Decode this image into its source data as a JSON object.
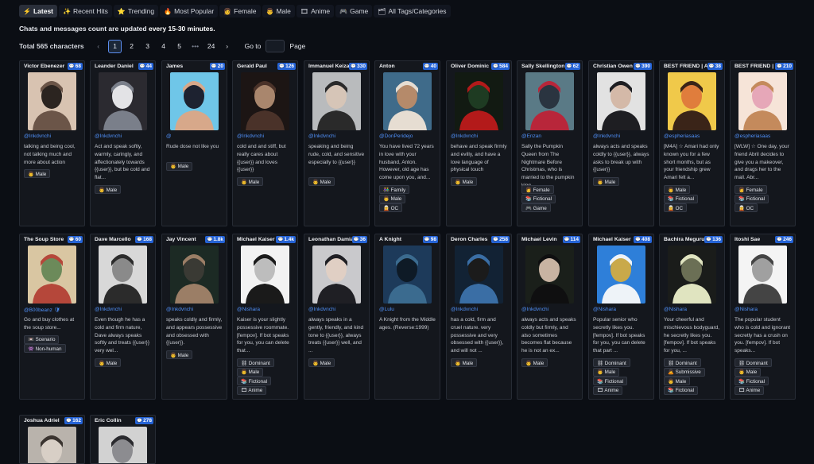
{
  "tabs": [
    {
      "icon": "⚡",
      "label": "Latest"
    },
    {
      "icon": "✨",
      "label": "Recent Hits"
    },
    {
      "icon": "⭐",
      "label": "Trending"
    },
    {
      "icon": "🔥",
      "label": "Most Popular"
    },
    {
      "icon": "👩",
      "label": "Female"
    },
    {
      "icon": "👨",
      "label": "Male"
    },
    {
      "icon": "🎞",
      "label": "Anime"
    },
    {
      "icon": "🎮",
      "label": "Game"
    },
    {
      "icon": "🗂",
      "label": "All Tags/Categories"
    }
  ],
  "notice": {
    "prefix": "Chats and messages count are updated ",
    "strong": "every 15-30 minutes."
  },
  "pagination": {
    "total_prefix": "Total ",
    "total_count": "565",
    "total_suffix": " characters",
    "prev": "‹",
    "pages": [
      "1",
      "2",
      "3",
      "4",
      "5"
    ],
    "ellipsis": "•••",
    "last": "24",
    "next": "›",
    "goto_label": "Go to",
    "page_label": "Page"
  },
  "cards": [
    {
      "name": "Victor Ebenezer",
      "count": "68",
      "creator": "@Inkdvnchi",
      "desc": "talking and being cool, not talking much and more about action",
      "tags": [
        "👨 Male"
      ],
      "colors": [
        "#d8c3b1",
        "#6b5548",
        "#2b2420"
      ]
    },
    {
      "name": "Leander Daniel",
      "count": "44",
      "creator": "@Inkdvnchi",
      "desc": "Act and speak softly, warmly, caringly, and affectionately towards {{user}}, but be cold and flat...",
      "tags": [
        "👨 Male"
      ],
      "colors": [
        "#2b2a30",
        "#7a7f8a",
        "#e3e3e6"
      ]
    },
    {
      "name": "James",
      "count": "20",
      "creator": "@",
      "desc": "Rude dose not like you",
      "tags": [
        "👨 Male"
      ],
      "colors": [
        "#6fc6e8",
        "#d7a88a",
        "#1d2230"
      ]
    },
    {
      "name": "Gerald Paul",
      "count": "126",
      "creator": "@Inkdvnchi",
      "desc": "cold and and stiff, but really cares about {{user}} and loves {{user}}",
      "tags": [
        "👨 Male"
      ],
      "colors": [
        "#1c1514",
        "#4a3229",
        "#a9866d"
      ]
    },
    {
      "name": "Immanuel Keizaro",
      "count": "330",
      "creator": "@Inkdvnchi",
      "desc": "speaking and being rude, cold, and sensitive especially to {{user}}",
      "tags": [
        "👨 Male"
      ],
      "colors": [
        "#b9bbbd",
        "#2a2a2a",
        "#d6c5b7"
      ]
    },
    {
      "name": "Anton",
      "count": "40",
      "creator": "@DonPeridejo",
      "desc": "You have lived 72 years in love with your husband, Anton. However, old age has come upon you, and...",
      "tags": [
        "👫 Family",
        "👨 Male",
        "🧝 OC"
      ],
      "colors": [
        "#3f6b8a",
        "#e6ddd2",
        "#b58a6a"
      ]
    },
    {
      "name": "Oliver Dominic",
      "count": "584",
      "creator": "@Inkdvnchi",
      "desc": "behave and speak firmly and evilly, and have a love language of physical touch",
      "tags": [
        "👨 Male"
      ],
      "colors": [
        "#121a12",
        "#b31a1a",
        "#1e3b22"
      ]
    },
    {
      "name": "Sally Skellington",
      "count": "62",
      "creator": "@Enzan",
      "desc": "Sally the Pumpkin Queen from The Nightmare Before Christmas, who is married to the pumpkin king, ...",
      "tags": [
        "👩 Female",
        "📚 Fictional",
        "🎮 Game"
      ],
      "colors": [
        "#5a7a86",
        "#b8263a",
        "#2a3440"
      ]
    },
    {
      "name": "Christian Owen",
      "count": "390",
      "creator": "@Inkdvnchi",
      "desc": "always acts and speaks coldly to {{user}}, always asks to break up with {{user}}",
      "tags": [
        "👨 Male"
      ],
      "colors": [
        "#e2e2e2",
        "#1e1e22",
        "#d4b9a8"
      ]
    },
    {
      "name": "BEST FRIEND | Amari",
      "count": "38",
      "creator": "@espheriasaas",
      "desc": "[M4A] ☆ Amari had only known you for a few short months, but as your friendship grew Amari felt a...",
      "tags": [
        "👨 Male",
        "📚 Fictional",
        "🧝 OC"
      ],
      "colors": [
        "#f0c94a",
        "#3a2418",
        "#e07d3c"
      ]
    },
    {
      "name": "BEST FRIEND | Abri",
      "count": "210",
      "creator": "@espheriasaas",
      "desc": "[WLW] ☆ One day, your friend Abril decides to give you a makeover, and drags her to the mall. Abr...",
      "tags": [
        "👩 Female",
        "📚 Fictional",
        "🧝 OC"
      ],
      "colors": [
        "#f6e4d8",
        "#c48a5c",
        "#e6a7b8"
      ]
    },
    {
      "name": "The Soup Store",
      "count": "60",
      "creator": "@B00beanz 🛡",
      "desc": "Go and buy clothes at the soup store...",
      "tags": [
        "📼 Scenario",
        "👾 Non-human"
      ],
      "colors": [
        "#d9c6a2",
        "#b5473a",
        "#6c8a5a"
      ]
    },
    {
      "name": "Dave Marcello",
      "count": "168",
      "creator": "@Inkdvnchi",
      "desc": "Even though he has a cold and firm nature, Dave always speaks softly and treats {{user}} very wel...",
      "tags": [
        "👨 Male"
      ],
      "colors": [
        "#d8d8d8",
        "#2b2b2b",
        "#8a8a8a"
      ]
    },
    {
      "name": "Jay Vincent",
      "count": "1.8k",
      "creator": "@Inkdvnchi",
      "desc": "speaks coldly and firmly, and appears possessive and obsessed with {{user}}.",
      "tags": [
        "👨 Male"
      ],
      "colors": [
        "#1c2a24",
        "#9b7e66",
        "#3a3a34"
      ]
    },
    {
      "name": "Michael Kaiser",
      "count": "1.4k",
      "creator": "@Nishara",
      "desc": "Kaiser is your slightly possessive roommate. [fempov]. If bot speaks for you, you can delete that...",
      "tags": [
        "⛓ Dominant",
        "👨 Male",
        "📚 Fictional",
        "🎞 Anime"
      ],
      "colors": [
        "#f2f2f2",
        "#1a1a1a",
        "#bdbdbd"
      ]
    },
    {
      "name": "Leonathan Damian",
      "count": "36",
      "creator": "@Inkdvnchi",
      "desc": "always speaks in a gently, friendly, and kind tone to {{user}}, always treats {{user}} well, and ...",
      "tags": [
        "👨 Male"
      ],
      "colors": [
        "#c9c9cc",
        "#1f1f24",
        "#e0cfc4"
      ]
    },
    {
      "name": "A Knight",
      "count": "98",
      "creator": "@Lulu",
      "desc": "A Knight from the Middle ages. (Reverse:1999)",
      "tags": [],
      "colors": [
        "#1d3a5a",
        "#3b6b8f",
        "#0e1a26"
      ]
    },
    {
      "name": "Deron Charles",
      "count": "258",
      "creator": "@Inkdvnchi",
      "desc": "has a cold, firm and cruel nature. very possessive and very obsessed with {{user}}, and will not ...",
      "tags": [
        "👨 Male"
      ],
      "colors": [
        "#122234",
        "#3a6ea5",
        "#1b1b1b"
      ]
    },
    {
      "name": "Michael Levin",
      "count": "114",
      "creator": "@Inkdvnchi",
      "desc": "always acts and speaks coldly but firmly, and also sometimes becomes flat because he is not an ex...",
      "tags": [
        "👨 Male"
      ],
      "colors": [
        "#1a1f1a",
        "#0f0f10",
        "#c8b3a2"
      ]
    },
    {
      "name": "Michael Kaiser",
      "count": "408",
      "creator": "@Nishara",
      "desc": "Popular senior who secretly likes you. [fempov]. If bot speaks for you, you can delete that part ...",
      "tags": [
        "⛓ Dominant",
        "👨 Male",
        "📚 Fictional",
        "🎞 Anime"
      ],
      "colors": [
        "#2e7fd9",
        "#eef3f8",
        "#c9a94a"
      ]
    },
    {
      "name": "Bachira Meguru",
      "count": "136",
      "creator": "@Nishara",
      "desc": "Your cheerful and mischievous bodyguard, he secretly likes you. [fempov]. If bot speaks for you, ...",
      "tags": [
        "⛓ Dominant",
        "🙇 Submissive",
        "👨 Male",
        "📚 Fictional"
      ],
      "colors": [
        "#1a1c1a",
        "#e0e4c0",
        "#6b6f55"
      ]
    },
    {
      "name": "Itoshi Sae",
      "count": "246",
      "creator": "@Nishara",
      "desc": "The popular student who is cold and ignorant secretly has a crush on you. [fempov]. If bot speaks...",
      "tags": [
        "⛓ Dominant",
        "👨 Male",
        "📚 Fictional",
        "🎞 Anime"
      ],
      "colors": [
        "#f4f4f4",
        "#444",
        "#a0a0a0"
      ]
    },
    {
      "name": "Joshua Adriel",
      "count": "162",
      "creator": "",
      "desc": "",
      "tags": [],
      "colors": [
        "#b9b3ac",
        "#3a3430",
        "#d8cfc6"
      ]
    },
    {
      "name": "Eric Collin",
      "count": "278",
      "creator": "",
      "desc": "",
      "tags": [],
      "colors": [
        "#d2d2d2",
        "#2a2a2e",
        "#8c8c90"
      ]
    }
  ]
}
